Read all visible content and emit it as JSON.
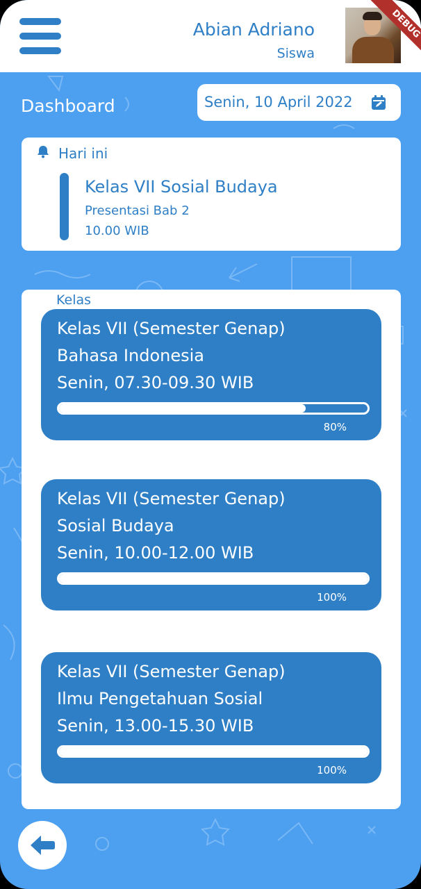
{
  "header": {
    "user_name": "Abian Adriano",
    "user_role": "Siswa",
    "debug_label": "DEBUG"
  },
  "dashboard": {
    "title": "Dashboard",
    "date": "Senin, 10 April 2022"
  },
  "today": {
    "label": "Hari ini",
    "class_name": "Kelas VII Sosial Budaya",
    "activity": "Presentasi Bab 2",
    "time": "10.00 WIB"
  },
  "classes": {
    "label": "Kelas",
    "items": [
      {
        "semester": "Kelas VII (Semester Genap)",
        "subject": "Bahasa Indonesia",
        "schedule": "Senin, 07.30-09.30 WIB",
        "progress": 0.8,
        "progress_label": "80%"
      },
      {
        "semester": "Kelas VII (Semester Genap)",
        "subject": "Sosial Budaya",
        "schedule": "Senin, 10.00-12.00 WIB",
        "progress": 1.0,
        "progress_label": "100%"
      },
      {
        "semester": "Kelas VII (Semester Genap)",
        "subject": "Ilmu Pengetahuan Sosial",
        "schedule": "Senin, 13.00-15.30 WIB",
        "progress": 1.0,
        "progress_label": "100%"
      }
    ]
  },
  "icons": {
    "menu": "menu-icon",
    "calendar": "calendar-edit-icon",
    "bell": "bell-icon",
    "back": "arrow-left-icon"
  },
  "colors": {
    "primary": "#2f7fc6",
    "background": "#4d9ff0",
    "surface": "#ffffff"
  }
}
